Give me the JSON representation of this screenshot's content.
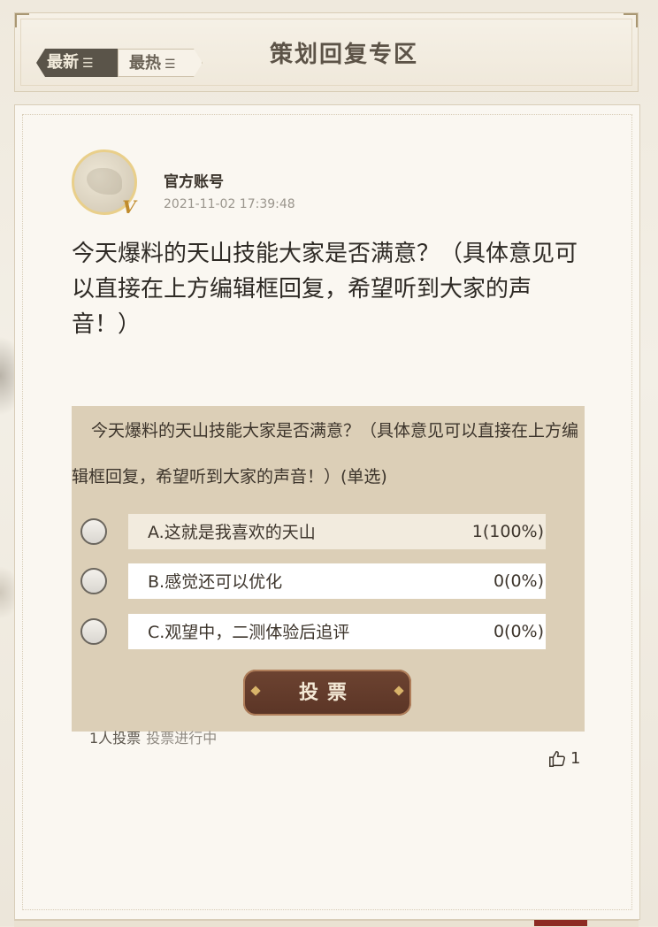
{
  "header": {
    "title": "策划回复专区",
    "tabs": [
      {
        "label": "最新",
        "icon": "sort-icon",
        "active": true
      },
      {
        "label": "最热",
        "icon": "sort-icon",
        "active": false
      }
    ]
  },
  "post": {
    "author": "官方账号",
    "timestamp": "2021-11-02 17:39:48",
    "badge_icon": "vip-v-icon",
    "title": "今天爆料的天山技能大家是否满意？（具体意见可以直接在上方编辑框回复，希望听到大家的声音！）"
  },
  "poll": {
    "question": "今天爆料的天山技能大家是否满意？（具体意见可以直接在上方编辑框回复，希望听到大家的声音！）(单选)",
    "options": [
      {
        "label": "A.这就是我喜欢的天山",
        "count": "1(100%)",
        "fraction": 1.0
      },
      {
        "label": "B.感觉还可以优化",
        "count": "0(0%)",
        "fraction": 0.0
      },
      {
        "label": "C.观望中，二测体验后追评",
        "count": "0(0%)",
        "fraction": 0.0
      }
    ],
    "vote_button": "投票",
    "voters": "1人投票",
    "status": "投票进行中"
  },
  "likes": "1",
  "colors": {
    "poll_bg": "#dccfb7",
    "button_brown": "#6d4331",
    "card_bg": "#faf7f1"
  }
}
